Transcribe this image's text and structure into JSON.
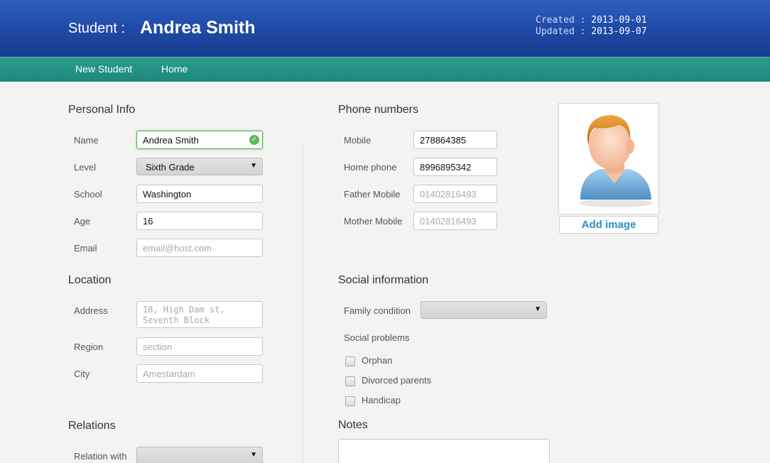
{
  "header": {
    "title_label": "Student :",
    "student_name": "Andrea Smith",
    "created_label": "Created : ",
    "created_value": "2013-09-01",
    "updated_label": "Updated : ",
    "updated_value": "2013-09-07"
  },
  "nav": {
    "new_student": "New Student",
    "home": "Home"
  },
  "personal_info": {
    "title": "Personal Info",
    "name_label": "Name",
    "name_value": "Andrea Smith",
    "level_label": "Level",
    "level_value": "Sixth Grade",
    "school_label": "School",
    "school_value": "Washington",
    "age_label": "Age",
    "age_value": "16",
    "email_label": "Email",
    "email_placeholder": "email@host.com"
  },
  "location": {
    "title": "Location",
    "address_label": "Address",
    "address_placeholder": "18, High Dam st, Seventh Block",
    "region_label": "Region",
    "region_placeholder": "section",
    "city_label": "City",
    "city_placeholder": "Amestardam"
  },
  "relations": {
    "title": "Relations",
    "relation_with_label": "Relation with"
  },
  "phones": {
    "title": "Phone numbers",
    "mobile_label": "Mobile",
    "mobile_value": "278864385",
    "home_label": "Home phone",
    "home_value": "8996895342",
    "father_label": "Father Mobile",
    "father_placeholder": "01402816493",
    "mother_label": "Mother Mobile",
    "mother_placeholder": "01402816493"
  },
  "photo": {
    "add_image": "Add image",
    "icon": "user-avatar-icon"
  },
  "social": {
    "title": "Social information",
    "family_condition_label": "Family condition",
    "social_problems_label": "Social problems",
    "problems": [
      "Orphan",
      "Divorced parents",
      "Handicap"
    ]
  },
  "notes": {
    "title": "Notes"
  },
  "colors": {
    "header": "#1f4aa6",
    "nav": "#1d897c",
    "link": "#2a8fc8",
    "valid": "#5cb85c"
  }
}
